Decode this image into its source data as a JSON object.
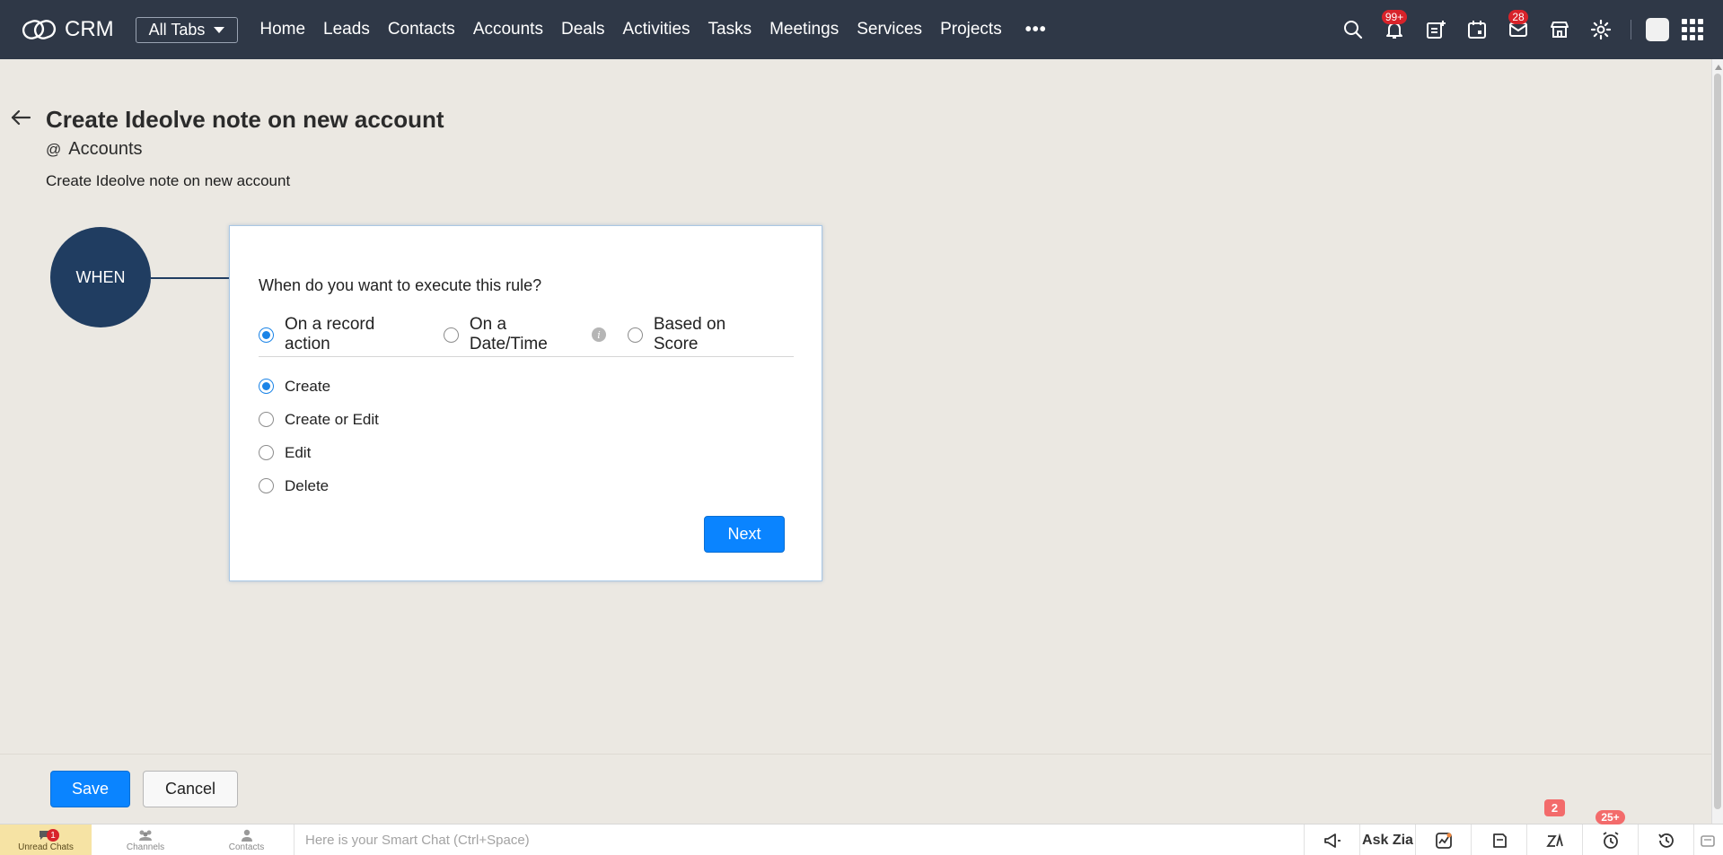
{
  "app": {
    "logo_text": "CRM",
    "all_tabs_label": "All Tabs"
  },
  "nav": {
    "tabs": [
      "Home",
      "Leads",
      "Contacts",
      "Accounts",
      "Deals",
      "Activities",
      "Tasks",
      "Meetings",
      "Services",
      "Projects"
    ],
    "more_label": "•••"
  },
  "top_icons": {
    "notifications_badge": "99+",
    "mail_badge": "28"
  },
  "page": {
    "title": "Create Ideolve note on new account",
    "module_prefix": "@",
    "module": "Accounts",
    "description": "Create Ideolve note on new account"
  },
  "rule": {
    "when_label": "WHEN",
    "question": "When do you want to execute this rule?",
    "trigger_options": [
      {
        "label": "On a record action",
        "checked": true
      },
      {
        "label": "On a Date/Time",
        "checked": false
      },
      {
        "label": "Based on Score",
        "checked": false
      }
    ],
    "action_options": [
      {
        "label": "Create",
        "checked": true
      },
      {
        "label": "Create or Edit",
        "checked": false
      },
      {
        "label": "Edit",
        "checked": false
      },
      {
        "label": "Delete",
        "checked": false
      }
    ],
    "next_label": "Next"
  },
  "footer": {
    "save_label": "Save",
    "cancel_label": "Cancel"
  },
  "bottom_bar": {
    "unread_chats_label": "Unread Chats",
    "unread_chats_badge": "1",
    "channels_label": "Channels",
    "contacts_label": "Contacts",
    "smart_chat_placeholder": "Here is your Smart Chat (Ctrl+Space)",
    "ask_zia_label": "Ask Zia",
    "zia_badge": "2",
    "reminders_badge": "25+"
  },
  "colors": {
    "topbar": "#2f3847",
    "accent": "#0a84ff",
    "when_node": "#203d61",
    "badge": "#d8232a"
  }
}
